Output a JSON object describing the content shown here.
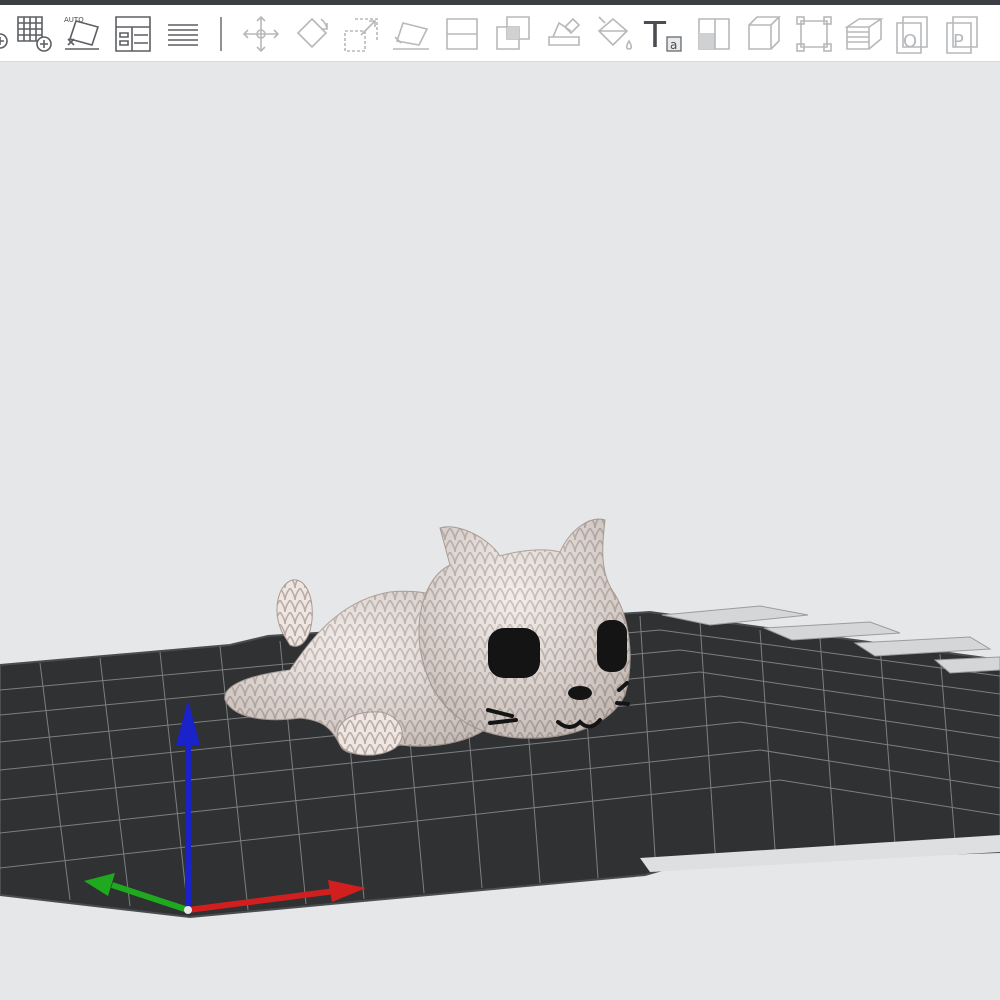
{
  "toolbar": {
    "auto_label": "AUTO",
    "text_tool_glyph": "T",
    "text_tool_sub": "a",
    "disabled_color": "#b6b8bb",
    "enabled_color": "#5b5e62",
    "items": [
      {
        "name": "add-icon",
        "enabled": true
      },
      {
        "name": "arrange-grid-icon",
        "enabled": true
      },
      {
        "name": "auto-orient-icon",
        "enabled": true
      },
      {
        "name": "layout-icon",
        "enabled": true
      },
      {
        "name": "layers-list-icon",
        "enabled": true
      },
      {
        "name": "move-icon",
        "enabled": false
      },
      {
        "name": "rotate-icon",
        "enabled": false
      },
      {
        "name": "scale-icon",
        "enabled": false
      },
      {
        "name": "lay-on-face-icon",
        "enabled": false
      },
      {
        "name": "cut-icon",
        "enabled": false
      },
      {
        "name": "boolean-icon",
        "enabled": false
      },
      {
        "name": "support-paint-icon",
        "enabled": false
      },
      {
        "name": "color-paint-icon",
        "enabled": false
      },
      {
        "name": "text-tool-icon",
        "enabled": true
      },
      {
        "name": "seam-paint-icon",
        "enabled": false
      },
      {
        "name": "measure-icon",
        "enabled": false
      },
      {
        "name": "assembly-icon",
        "enabled": false
      },
      {
        "name": "variable-layer-icon",
        "enabled": false
      },
      {
        "name": "object-o-icon",
        "enabled": false
      },
      {
        "name": "object-p-icon",
        "enabled": false
      }
    ]
  },
  "viewport": {
    "model": "knitted cat",
    "bed_color": "#2f3133",
    "grid_color": "#7c7f82",
    "model_color": "#ede4df",
    "axis_x_color": "#d11f1f",
    "axis_y_color": "#1fa91f",
    "axis_z_color": "#1a22c9"
  }
}
